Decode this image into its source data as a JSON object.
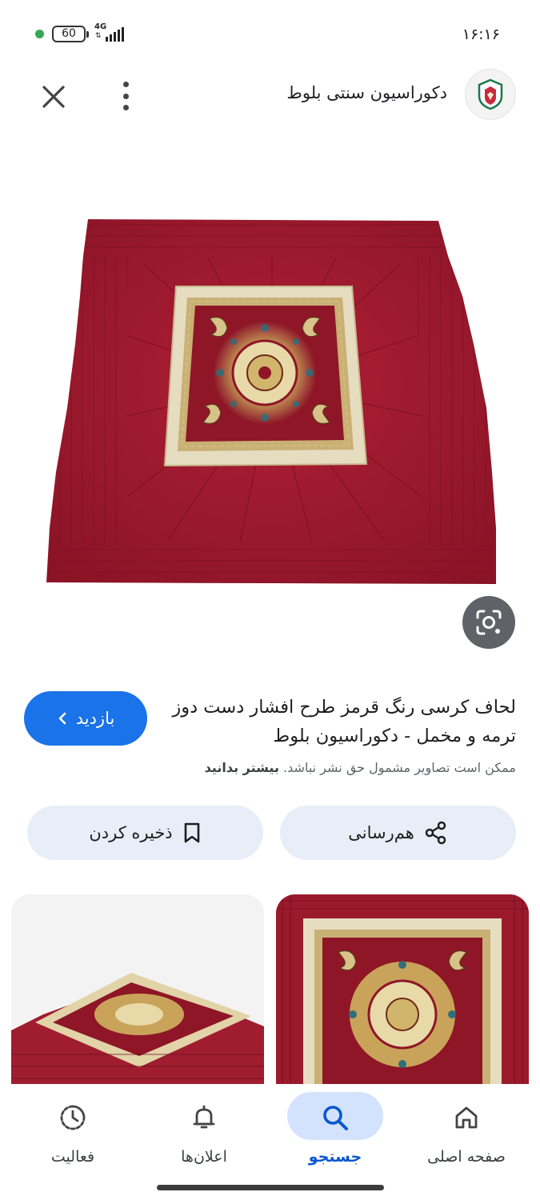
{
  "status_bar": {
    "battery": "60",
    "network": "4G",
    "time": "۱۶:۱۶",
    "dot_color": "#34a853"
  },
  "top_bar": {
    "site_name": "دکوراسیون سنتی بلوط",
    "close_icon": "close-icon",
    "more_icon": "more-vert-icon"
  },
  "main_image": {
    "subject": "red quilted velvet blanket with paisley termeh centre panel"
  },
  "result": {
    "title": "لحاف کرسی رنگ قرمز طرح افشار دست دوز ترمه و مخمل - دکوراسیون بلوط",
    "disclaimer_text": "ممکن است تصاویر مشمول حق نشر نباشد.",
    "disclaimer_link": "بیشتر بدانید",
    "visit_label": "بازدید"
  },
  "actions": {
    "share_label": "هم‌رسانی",
    "save_label": "ذخیره کردن"
  },
  "bottom_nav": {
    "items": [
      {
        "label": "صفحه اصلی",
        "icon": "home-icon"
      },
      {
        "label": "جستجو",
        "icon": "search-icon",
        "active": true
      },
      {
        "label": "اعلان‌ها",
        "icon": "bell-icon"
      },
      {
        "label": "فعالیت",
        "icon": "activity-icon"
      }
    ]
  },
  "colors": {
    "accent": "#1a73e8",
    "active_nav": "#0b57d0",
    "button_bg": "#e8eef8",
    "blanket_red": "#9a1a2c"
  }
}
